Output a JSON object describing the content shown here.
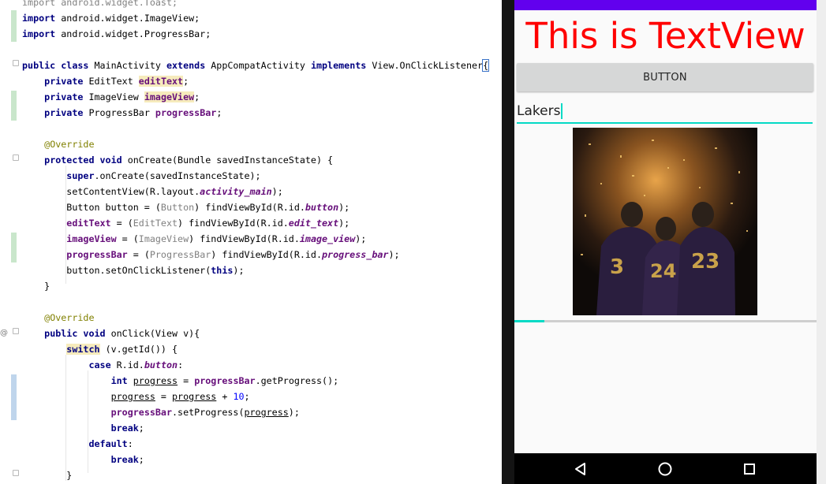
{
  "editor": {
    "lines": [
      [
        [
          "import android.widget.Toast;",
          "gray"
        ]
      ],
      [
        [
          "import",
          "kw"
        ],
        [
          " android.widget.ImageView;",
          ""
        ]
      ],
      [
        [
          "import",
          "kw"
        ],
        [
          " android.widget.ProgressBar;",
          ""
        ]
      ],
      [],
      [
        [
          "public class",
          "kw"
        ],
        [
          " MainActivity ",
          ""
        ],
        [
          "extends",
          "kw"
        ],
        [
          " AppCompatActivity ",
          ""
        ],
        [
          "implements",
          "kw"
        ],
        [
          " View.OnClickListener",
          ""
        ],
        [
          "{",
          "caretbox"
        ]
      ],
      [
        [
          "    ",
          ""
        ],
        [
          "private",
          "kw"
        ],
        [
          " EditText ",
          ""
        ],
        [
          "editText",
          "fld hl"
        ],
        [
          ";",
          ""
        ]
      ],
      [
        [
          "    ",
          ""
        ],
        [
          "private",
          "kw"
        ],
        [
          " ImageView ",
          ""
        ],
        [
          "imageView",
          "fld hl"
        ],
        [
          ";",
          ""
        ]
      ],
      [
        [
          "    ",
          ""
        ],
        [
          "private",
          "kw"
        ],
        [
          " ProgressBar ",
          ""
        ],
        [
          "progressBar",
          "fld"
        ],
        [
          ";",
          ""
        ]
      ],
      [],
      [
        [
          "    ",
          ""
        ],
        [
          "@Override",
          "an"
        ]
      ],
      [
        [
          "    ",
          ""
        ],
        [
          "protected void",
          "kw"
        ],
        [
          " onCreate(Bundle savedInstanceState) {",
          ""
        ]
      ],
      [
        [
          "        ",
          ""
        ],
        [
          "super",
          "kw"
        ],
        [
          ".onCreate(savedInstanceState);",
          ""
        ]
      ],
      [
        [
          "        setContentView(R.layout.",
          ""
        ],
        [
          "activity_main",
          "st"
        ],
        [
          ");",
          ""
        ]
      ],
      [
        [
          "        Button button = (",
          ""
        ],
        [
          "Button",
          "cast"
        ],
        [
          ") findViewById(R.id.",
          ""
        ],
        [
          "button",
          "st"
        ],
        [
          ");",
          ""
        ]
      ],
      [
        [
          "        ",
          ""
        ],
        [
          "editText",
          "fld"
        ],
        [
          " = (",
          ""
        ],
        [
          "EditText",
          "cast"
        ],
        [
          ") findViewById(R.id.",
          ""
        ],
        [
          "edit_text",
          "st"
        ],
        [
          ");",
          ""
        ]
      ],
      [
        [
          "        ",
          ""
        ],
        [
          "imageView",
          "fld"
        ],
        [
          " = (",
          ""
        ],
        [
          "ImageView",
          "cast"
        ],
        [
          ") findViewById(R.id.",
          ""
        ],
        [
          "image_view",
          "st"
        ],
        [
          ");",
          ""
        ]
      ],
      [
        [
          "        ",
          ""
        ],
        [
          "progressBar",
          "fld"
        ],
        [
          " = (",
          ""
        ],
        [
          "ProgressBar",
          "cast"
        ],
        [
          ") findViewById(R.id.",
          ""
        ],
        [
          "progress_bar",
          "st"
        ],
        [
          ");",
          ""
        ]
      ],
      [
        [
          "        button.setOnClickListener(",
          ""
        ],
        [
          "this",
          "kw"
        ],
        [
          ");",
          ""
        ]
      ],
      [
        [
          "    }",
          ""
        ]
      ],
      [],
      [
        [
          "    ",
          ""
        ],
        [
          "@Override",
          "an"
        ]
      ],
      [
        [
          "    ",
          ""
        ],
        [
          "public void",
          "kw"
        ],
        [
          " onClick(View v){",
          ""
        ]
      ],
      [
        [
          "        ",
          ""
        ],
        [
          "switch",
          "kw hl"
        ],
        [
          " (v.getId()) {",
          ""
        ]
      ],
      [
        [
          "            ",
          ""
        ],
        [
          "case",
          "kw"
        ],
        [
          " R.id.",
          ""
        ],
        [
          "button",
          "st"
        ],
        [
          ":",
          ""
        ]
      ],
      [
        [
          "                ",
          ""
        ],
        [
          "int",
          "kw"
        ],
        [
          " ",
          ""
        ],
        [
          "progress",
          "ul"
        ],
        [
          " = ",
          ""
        ],
        [
          "progressBar",
          "fld"
        ],
        [
          ".getProgress();",
          ""
        ]
      ],
      [
        [
          "                ",
          ""
        ],
        [
          "progress",
          "ul"
        ],
        [
          " = ",
          ""
        ],
        [
          "progress",
          "ul"
        ],
        [
          " + ",
          ""
        ],
        [
          "10",
          "num"
        ],
        [
          ";",
          ""
        ]
      ],
      [
        [
          "                ",
          ""
        ],
        [
          "progressBar",
          "fld"
        ],
        [
          ".setProgress(",
          ""
        ],
        [
          "progress",
          "ul"
        ],
        [
          ");",
          ""
        ]
      ],
      [
        [
          "                ",
          ""
        ],
        [
          "break",
          "kw"
        ],
        [
          ";",
          ""
        ]
      ],
      [
        [
          "            ",
          ""
        ],
        [
          "default",
          "kw"
        ],
        [
          ":",
          ""
        ]
      ],
      [
        [
          "                ",
          ""
        ],
        [
          "break",
          "kw"
        ],
        [
          ";",
          ""
        ]
      ],
      [
        [
          "        }",
          ""
        ]
      ]
    ],
    "gutter_markers": [
      "at-sign-marker"
    ]
  },
  "phone": {
    "textview": "This is TextView",
    "button_label": "BUTTON",
    "edittext_value": "Lakers",
    "progress_percent": 10,
    "image_alt": "Lakers players photo",
    "colors": {
      "status_bar": "#6200ee",
      "textview": "#ff0000",
      "accent": "#03dac5"
    },
    "nav": [
      "back-icon",
      "home-icon",
      "recents-icon"
    ]
  }
}
